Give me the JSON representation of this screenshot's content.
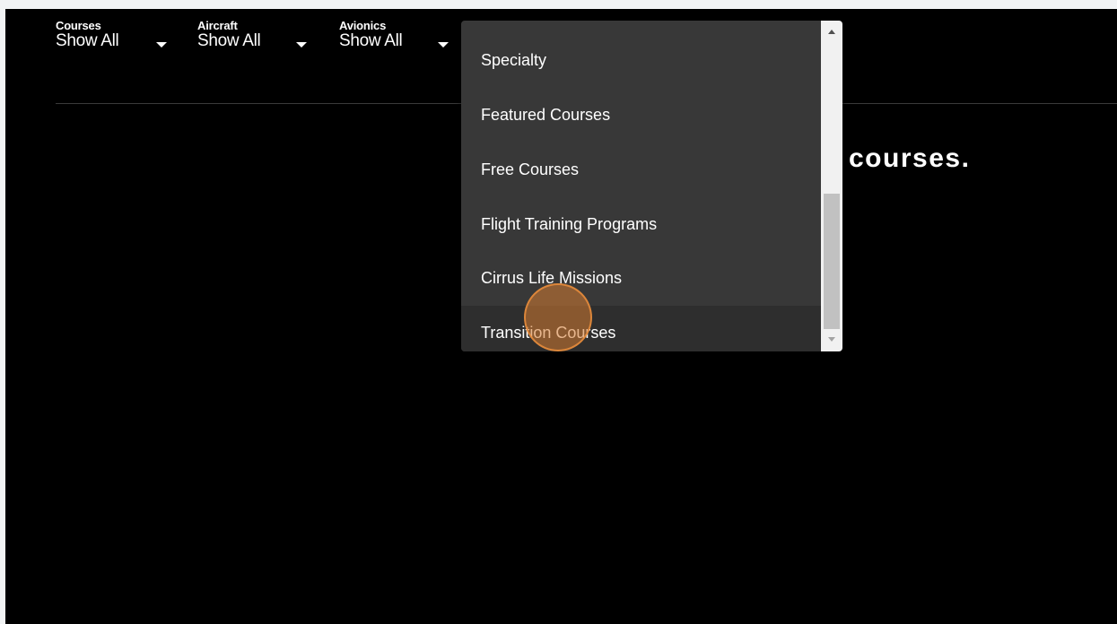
{
  "filters": [
    {
      "label": "Courses",
      "value": "Show All"
    },
    {
      "label": "Aircraft",
      "value": "Show All"
    },
    {
      "label": "Avionics",
      "value": "Show All"
    }
  ],
  "heading_visible_text": "courses.",
  "dropdown": {
    "items": [
      "Specialty",
      "Featured Courses",
      "Free Courses",
      "Flight Training Programs",
      "Cirrus Life Missions",
      "Transition Courses"
    ],
    "hovered_item": "Transition Courses"
  },
  "colors": {
    "page_background": "#000000",
    "dropdown_background": "#383838",
    "hover_background": "#2e2e2e",
    "click_indicator": "#d67c32"
  },
  "icons": {
    "filter_caret": "caret-down-icon",
    "scroll_up": "scroll-up-arrow-icon",
    "scroll_down": "scroll-down-arrow-icon"
  }
}
